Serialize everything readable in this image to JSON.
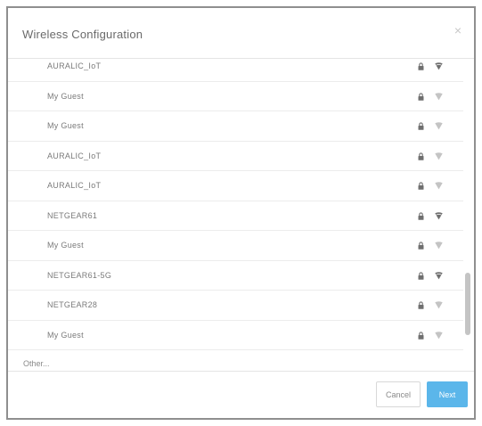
{
  "dialog": {
    "title": "Wireless Configuration",
    "close_glyph": "×"
  },
  "networks": [
    {
      "ssid": "AURALIC_IoT",
      "secured": true,
      "signal": "strong"
    },
    {
      "ssid": "My Guest",
      "secured": true,
      "signal": "weak"
    },
    {
      "ssid": "My Guest",
      "secured": true,
      "signal": "weak"
    },
    {
      "ssid": "AURALIC_IoT",
      "secured": true,
      "signal": "weak"
    },
    {
      "ssid": "AURALIC_IoT",
      "secured": true,
      "signal": "weak"
    },
    {
      "ssid": "NETGEAR61",
      "secured": true,
      "signal": "strong"
    },
    {
      "ssid": "My Guest",
      "secured": true,
      "signal": "weak"
    },
    {
      "ssid": "NETGEAR61-5G",
      "secured": true,
      "signal": "strong"
    },
    {
      "ssid": "NETGEAR28",
      "secured": true,
      "signal": "weak"
    },
    {
      "ssid": "My Guest",
      "secured": true,
      "signal": "weak"
    }
  ],
  "other_label": "Other...",
  "footer": {
    "cancel_label": "Cancel",
    "next_label": "Next"
  },
  "colors": {
    "primary": "#5bb6ea",
    "icon": "#6f6f6f",
    "icon_faint": "#c4c4c4"
  }
}
